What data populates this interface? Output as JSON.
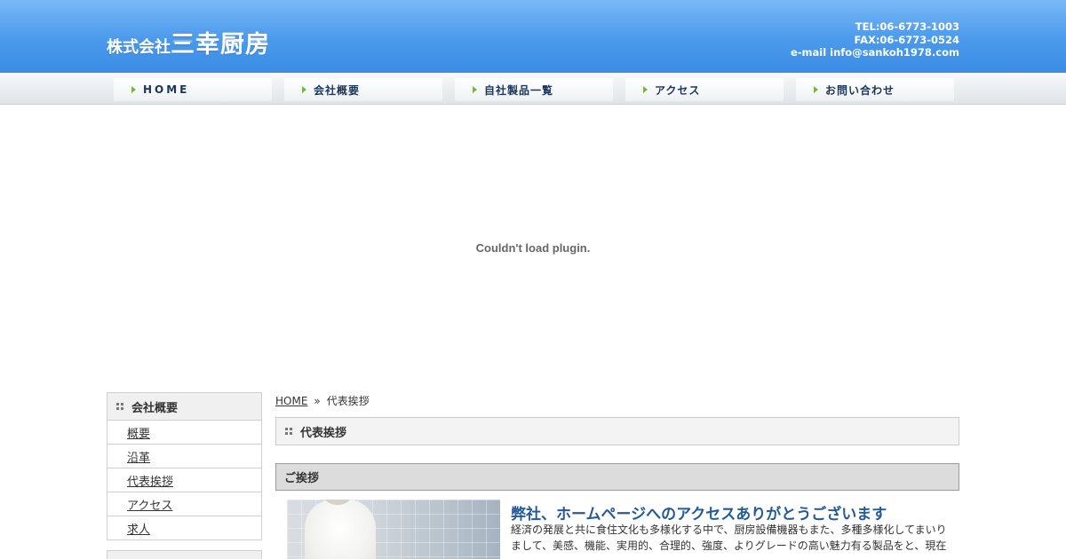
{
  "header": {
    "logo_prefix": "株式会社",
    "logo_name": "三幸厨房",
    "tel": "TEL:06-6773-1003",
    "fax": "FAX:06-6773-0524",
    "email": "e-mail info@sankoh1978.com"
  },
  "nav": {
    "items": [
      {
        "label": "HOME"
      },
      {
        "label": "会社概要"
      },
      {
        "label": "自社製品一覧"
      },
      {
        "label": "アクセス"
      },
      {
        "label": "お問い合わせ"
      }
    ]
  },
  "plugin": {
    "message": "Couldn't load plugin."
  },
  "sidebar": {
    "title": "会社概要",
    "items": [
      {
        "label": "概要"
      },
      {
        "label": "沿革"
      },
      {
        "label": "代表挨拶"
      },
      {
        "label": "アクセス"
      },
      {
        "label": "求人"
      }
    ]
  },
  "breadcrumb": {
    "home": "HOME",
    "separator": "»",
    "current": "代表挨拶"
  },
  "main": {
    "page_title": "代表挨拶",
    "section_title": "ご挨拶",
    "greeting_title": "弊社、ホームページへのアクセスありがとうございます",
    "greeting_body": "経済の発展と共に食住文化も多様化する中で、厨房設備機器もまた、多種多様化してまいりまして、美感、機能、実用的、合理的、強度、よりグレードの高い魅力有る製品をと、現在"
  },
  "colors": {
    "header_blue": "#4a99ec",
    "nav_text": "#1c3558",
    "nav_arrow": "#7cb342",
    "greeting_title": "#245a9a"
  }
}
